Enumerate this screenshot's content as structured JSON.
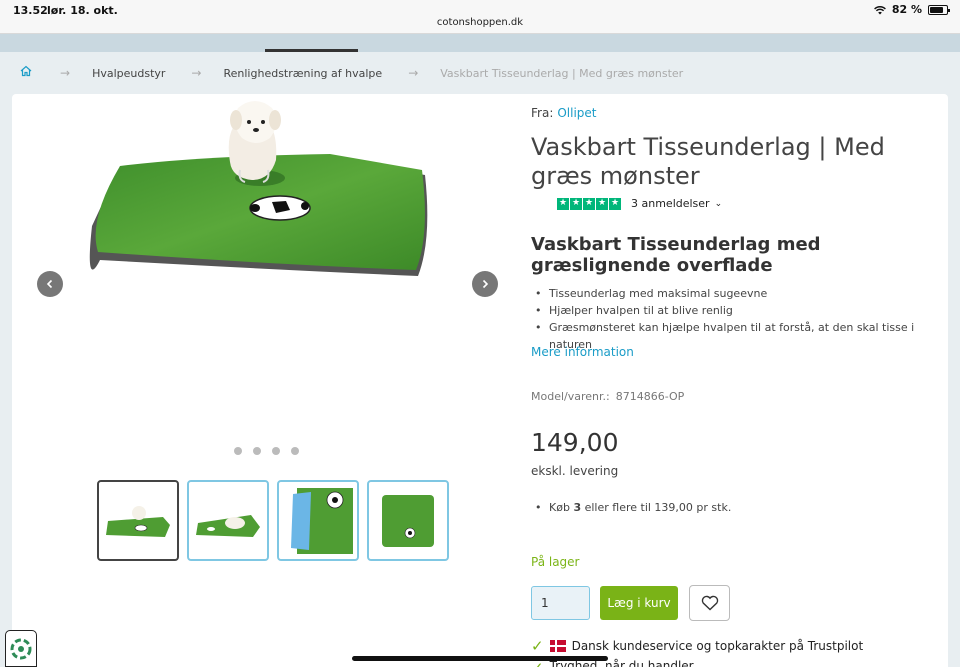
{
  "status_bar": {
    "time": "13.52",
    "date": "lør. 18. okt.",
    "url": "cotonshoppen.dk",
    "battery": "82 %",
    "battery_level": 0.82
  },
  "breadcrumb": {
    "items": [
      "Hvalpeudstyr",
      "Renlighedstræning af hvalpe"
    ],
    "current": "Vaskbart Tisseunderlag | Med græs mønster"
  },
  "product": {
    "brand_prefix": "Fra:",
    "brand": "Ollipet",
    "title": "Vaskbart Tisseunderlag | Med græs mønster",
    "rating_stars": 5,
    "reviews": "3 anmeldelser",
    "subtitle": "Vaskbart Tisseunderlag med græslignende overflade",
    "bullets": [
      "Tisseunderlag med maksimal sugeevne",
      "Hjælper hvalpen til at blive renlig",
      "Græsmønsteret kan hjælpe hvalpen til at forstå, at den skal tisse i naturen"
    ],
    "more_info": "Mere information",
    "model_label": "Model/varenr.:",
    "model_value": "8714866-OP",
    "price": "149,00",
    "price_note": "ekskl. levering",
    "bulk_prefix": "Køb",
    "bulk_qty": "3",
    "bulk_suffix": "eller flere til 139,00 pr stk.",
    "stock": "På lager",
    "quantity": "1",
    "add_to_cart": "Læg i kurv",
    "trust_line": "Dansk kundeservice og topkarakter på Trustpilot",
    "trust_line_2": "Tryghed, når du handler"
  },
  "gallery": {
    "dots": 4,
    "active_thumb": 0,
    "thumb_count": 4
  },
  "colors": {
    "accent": "#1a9cc7",
    "buy_button": "#7ab317",
    "stock": "#7cb518",
    "trustpilot": "#00b67a"
  }
}
